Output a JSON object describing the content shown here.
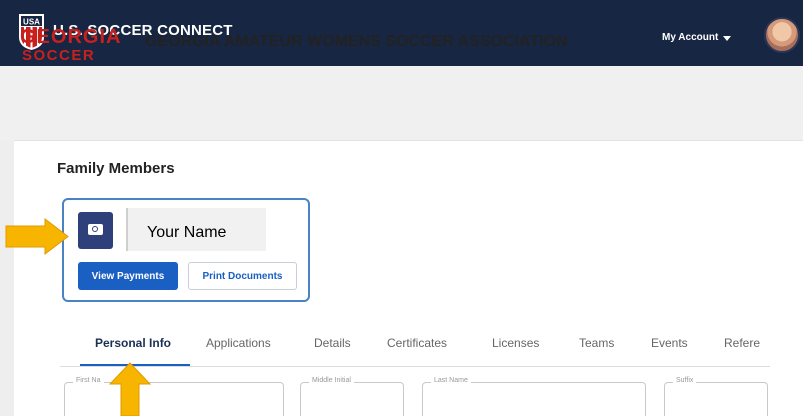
{
  "topbar": {
    "logo_text": "USA",
    "app_title": "U.S. SOCCER CONNECT",
    "account_label": "My Account"
  },
  "org": {
    "logo_line1": "GEORGIA",
    "logo_line2": "SOCCER",
    "title": "GEORGIA AMATEUR WOMENS SOCCER ASSOCIATION"
  },
  "family": {
    "section_title": "Family Members",
    "member_name": "Your Name",
    "view_payments_label": "View Payments",
    "print_documents_label": "Print Documents"
  },
  "tabs": [
    {
      "label": "Personal Info",
      "active": true
    },
    {
      "label": "Applications",
      "active": false
    },
    {
      "label": "Details",
      "active": false
    },
    {
      "label": "Certificates",
      "active": false
    },
    {
      "label": "Licenses",
      "active": false
    },
    {
      "label": "Teams",
      "active": false
    },
    {
      "label": "Events",
      "active": false
    },
    {
      "label": "Refere",
      "active": false
    }
  ],
  "form": {
    "first_name_label": "First Na",
    "middle_initial_label": "Middle Initial",
    "last_name_label": "Last Name",
    "suffix_label": "Suffix"
  },
  "colors": {
    "nav_bg": "#172643",
    "brand_red": "#c8201d",
    "accent_blue": "#1a5fc2",
    "arrow_yellow": "#f7b500"
  },
  "icons": {
    "account_caret": "chevron-down-icon",
    "photo": "camera-icon"
  }
}
